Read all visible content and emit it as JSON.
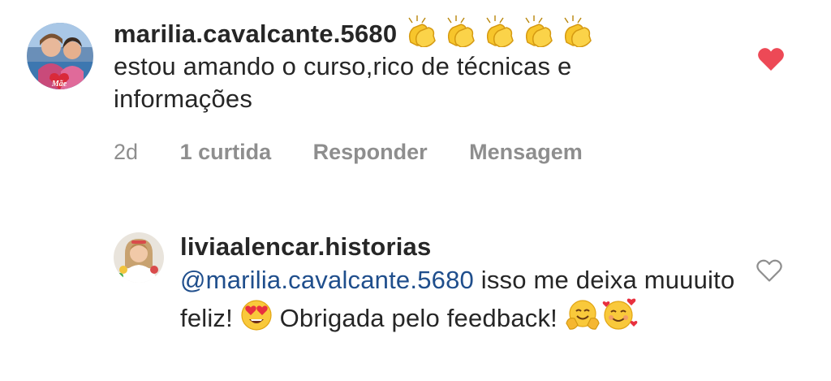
{
  "comments": [
    {
      "username": "marilia.cavalcante.5680",
      "text": "estou amando o curso,rico de técnicas e informações",
      "username_emoji": [
        "clapping-hands",
        "clapping-hands",
        "clapping-hands",
        "clapping-hands",
        "clapping-hands"
      ],
      "time": "2d",
      "likes": "1 curtida",
      "reply_label": "Responder",
      "message_label": "Mensagem",
      "liked": true,
      "avatar_badge_text": "Mãe"
    },
    {
      "username": "liviaalencar.historias",
      "mention": "@marilia.cavalcante.5680",
      "text_part1": " isso me deixa muuuito feliz! ",
      "text_part2": " Obrigada pelo feedback! ",
      "emojis": [
        "smiling-face-with-heart-eyes",
        "hugging-face",
        "smiling-face-with-hearts"
      ],
      "liked": false
    }
  ],
  "colors": {
    "text": "#262626",
    "muted": "#8e8e8e",
    "mention": "#1f4e8c",
    "like_red": "#ed4956",
    "outline_gray": "#8e8e8e"
  }
}
